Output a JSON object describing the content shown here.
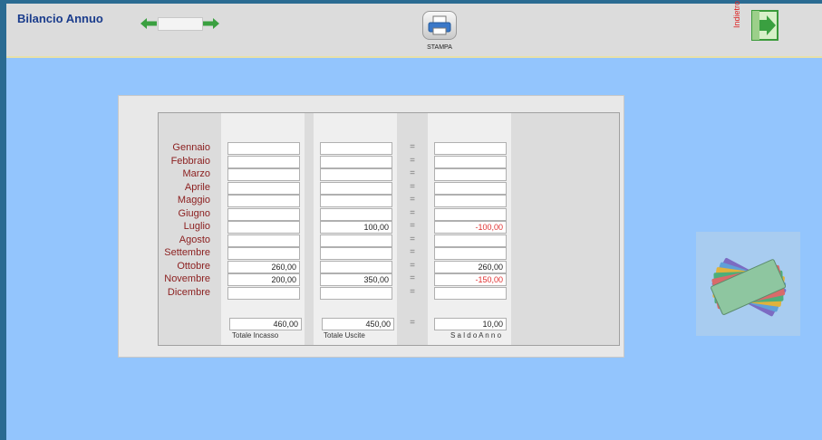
{
  "header": {
    "title": "Bilancio Annuo",
    "print_label": "STAMPA",
    "exit_label": "Indietro"
  },
  "months": [
    {
      "name": "Gennaio",
      "incasso": "",
      "uscite": "",
      "saldo": ""
    },
    {
      "name": "Febbraio",
      "incasso": "",
      "uscite": "",
      "saldo": ""
    },
    {
      "name": "Marzo",
      "incasso": "",
      "uscite": "",
      "saldo": ""
    },
    {
      "name": "Aprile",
      "incasso": "",
      "uscite": "",
      "saldo": ""
    },
    {
      "name": "Maggio",
      "incasso": "",
      "uscite": "",
      "saldo": ""
    },
    {
      "name": "Giugno",
      "incasso": "",
      "uscite": "",
      "saldo": ""
    },
    {
      "name": "Luglio",
      "incasso": "",
      "uscite": "100,00",
      "saldo": "-100,00"
    },
    {
      "name": "Agosto",
      "incasso": "",
      "uscite": "",
      "saldo": ""
    },
    {
      "name": "Settembre",
      "incasso": "",
      "uscite": "",
      "saldo": ""
    },
    {
      "name": "Ottobre",
      "incasso": "260,00",
      "uscite": "",
      "saldo": "260,00"
    },
    {
      "name": "Novembre",
      "incasso": "200,00",
      "uscite": "350,00",
      "saldo": "-150,00"
    },
    {
      "name": "Dicembre",
      "incasso": "",
      "uscite": "",
      "saldo": ""
    }
  ],
  "equals_sign": "=",
  "totals": {
    "incasso": "460,00",
    "uscite": "450,00",
    "saldo": "10,00",
    "incasso_label": "Totale Incasso",
    "uscite_label": "Totale Uscite",
    "saldo_label": "S a l d o  A n n o"
  },
  "colors": {
    "background": "#93c5fd",
    "header": "#dcdcdc",
    "title": "#1a3c8c",
    "month_label": "#8b1e1e",
    "negative": "#e03030",
    "arrow_green": "#3aa040"
  }
}
